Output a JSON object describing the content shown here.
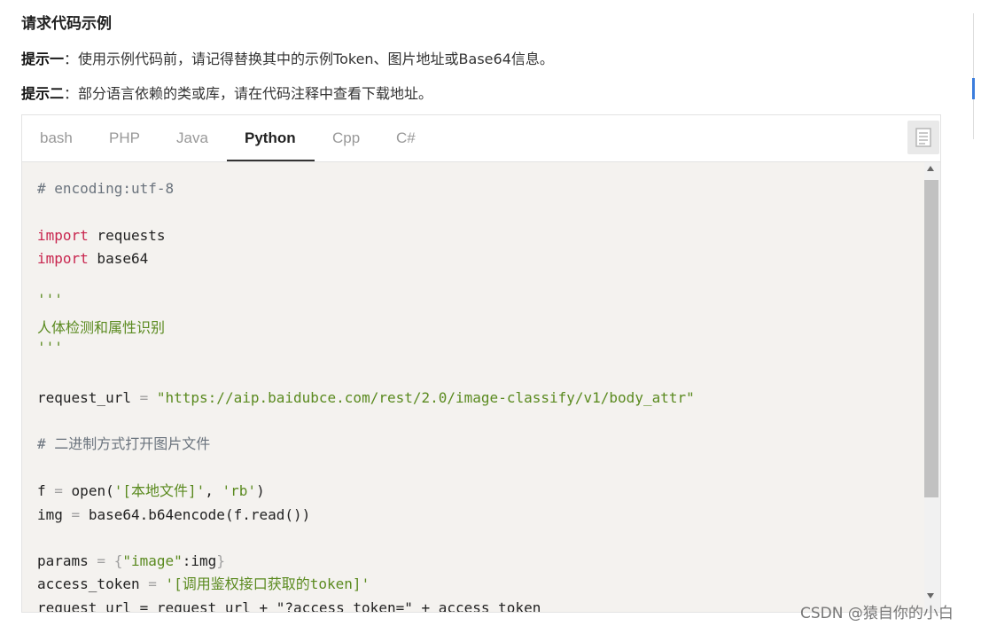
{
  "heading": "请求代码示例",
  "tips": [
    {
      "label": "提示一",
      "sep": "：",
      "text": "使用示例代码前，请记得替换其中的示例Token、图片地址或Base64信息。"
    },
    {
      "label": "提示二",
      "sep": "：",
      "text": "部分语言依赖的类或库，请在代码注释中查看下载地址。"
    }
  ],
  "tabs": [
    "bash",
    "PHP",
    "Java",
    "Python",
    "Cpp",
    "C#"
  ],
  "active_tab": "Python",
  "copy_icon": "copy-icon",
  "code": {
    "comment_encoding": "# encoding:utf-8",
    "kw_import": "import",
    "mod_requests": " requests",
    "mod_base64": " base64",
    "triple_quote": "'''",
    "docstring": "人体检测和属性识别",
    "request_url_var": "request_url",
    "eq": " = ",
    "request_url_val": "\"https://aip.baidubce.com/rest/2.0/image-classify/v1/body_attr\"",
    "comment_binary": "# 二进制方式打开图片文件",
    "f_var": "f",
    "open_call": "open(",
    "open_arg1": "'[本地文件]'",
    "comma": ", ",
    "open_arg2": "'rb'",
    "close_paren": ")",
    "img_var": "img",
    "b64_call": "base64.b64encode(f.read())",
    "params_var": "params",
    "lbrace": "{",
    "image_key": "\"image\"",
    "params_rest": ":img",
    "rbrace": "}",
    "access_token_var": "access_token",
    "access_token_val": "'[调用鉴权接口获取的token]'",
    "partial_line": "request_url = request_url + \"?access_token=\" + access_token"
  },
  "colors": {
    "keyword": "#c8254e",
    "string": "#5a8a1f",
    "comment": "#6a737d",
    "code_bg": "#f4f2ef"
  },
  "watermark": "CSDN @猿自你的小白"
}
